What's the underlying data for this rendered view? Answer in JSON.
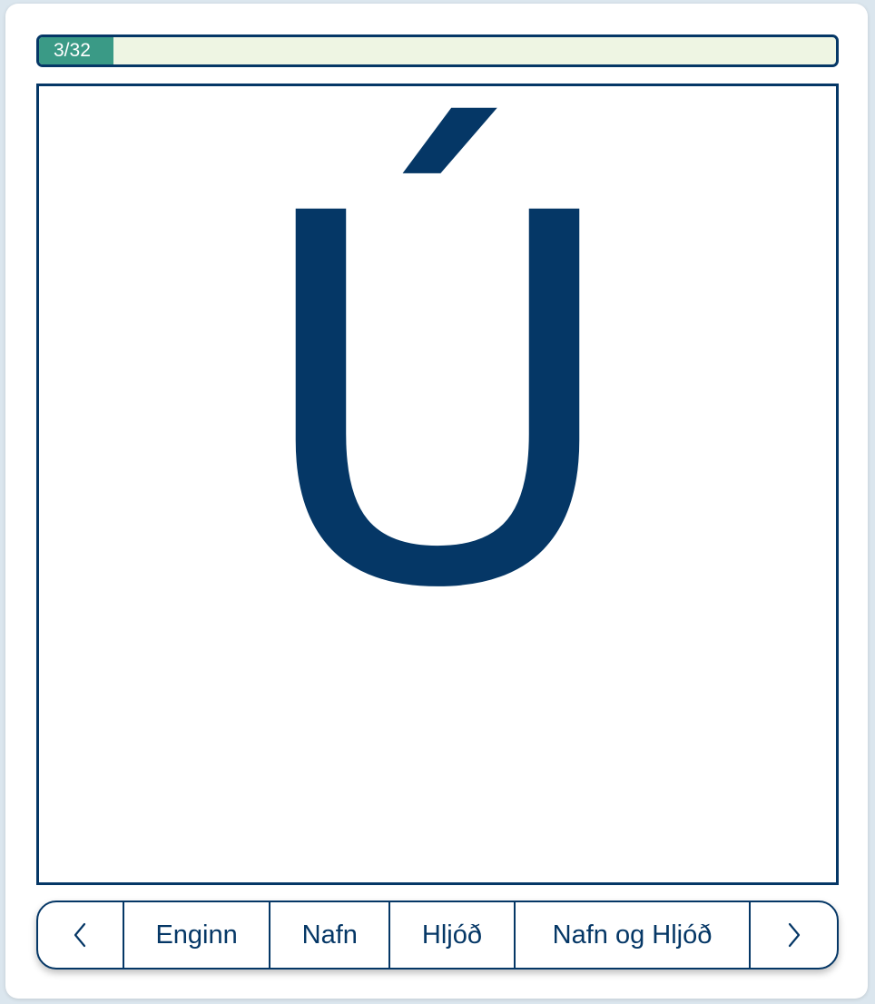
{
  "progress": {
    "label": "3/32",
    "current": 3,
    "total": 32,
    "fill_color": "#3a9a86"
  },
  "card": {
    "letter": "Ú",
    "letter_color": "#053766"
  },
  "controls": {
    "prev_icon": "chevron-left-icon",
    "next_icon": "chevron-right-icon",
    "options": [
      "Enginn",
      "Nafn",
      "Hljóð",
      "Nafn og Hljóð"
    ]
  }
}
